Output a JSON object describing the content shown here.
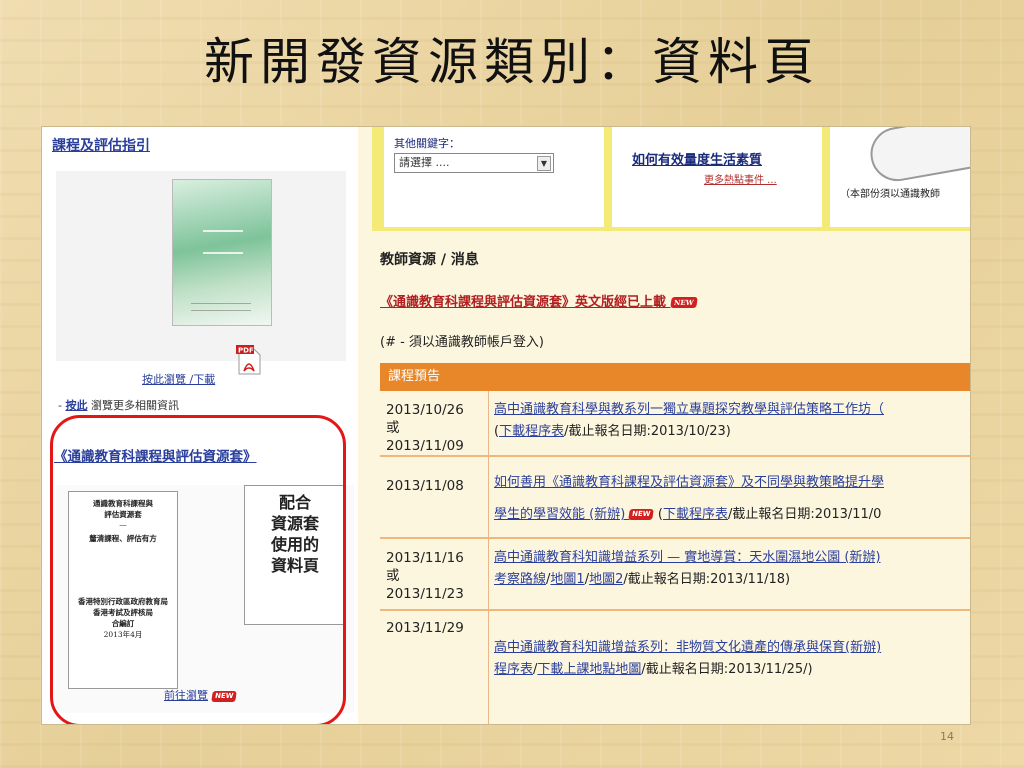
{
  "slide": {
    "title": "新開發資源類別：資料頁",
    "page_number": "14"
  },
  "left": {
    "title": "課程及評估指引",
    "pdf_link": "按此瀏覽 /下載",
    "more_prefix": "- ",
    "more_link": "按此",
    "more_text": " 瀏覽更多相關資訊",
    "set_title": "《通識教育科課程與評估資源套》",
    "doc_card": {
      "line1": "通識教育科課程與",
      "line2": "評估資源套",
      "dash": "—",
      "line3": "釐清課程、評估有方",
      "line4": "香港特別行政區政府教育局",
      "line5": "香港考試及評核局",
      "line6": "合編訂",
      "line7": "2013年4月"
    },
    "match_card": [
      "配合",
      "資源套",
      "使用的",
      "資料頁"
    ],
    "go_link": "前往瀏覽"
  },
  "top": {
    "keyword_label": "其他關鍵字：",
    "keyword_select": "請選擇 ....",
    "event_title": "如何有效量度生活素質",
    "event_more": "更多熱點事件 ...",
    "dash": "-",
    "note": "（本部份須以通識教師"
  },
  "resources": {
    "heading": "教師資源 / 消息",
    "link": "《通識教育科課程與評估資源套》英文版經已上載",
    "note": "(# - 須以通識教師帳戶登入)",
    "table_header": "課程預告"
  },
  "badge": "NEW",
  "rows": [
    {
      "date1": "2013/10/26",
      "or": "或",
      "date2": "2013/11/09",
      "title": "高中通識教育科學與教系列一獨立專題探究教學與評估策略工作坊（",
      "l1": "下載程序表",
      "tail1": "/截止報名日期:2013/10/23)"
    },
    {
      "date1": "2013/11/08",
      "title": "如何善用《通識教育科課程及評估資源套》及不同學與教策略提升學",
      "line2a": "學生的學習效能 (新辦) ",
      "l1": "下載程序表",
      "tail1": "/截止報名日期:2013/11/0"
    },
    {
      "date1": "2013/11/16",
      "or": "或",
      "date2": "2013/11/23",
      "title": "高中通識教育科知識增益系列 — 實地導賞：天水圍濕地公園 (新辦)",
      "l1": "考察路線",
      "l2": "地圖1",
      "l3": "地圖2",
      "tail1": "/截止報名日期:2013/11/18)"
    },
    {
      "date1": "2013/11/29",
      "title": "高中通識教育科知識增益系列：非物質文化遺產的傳承與保育(新辦)",
      "l1": "程序表",
      "l2": "下載上課地點地圖",
      "tail1": "/截止報名日期:2013/11/25/)"
    }
  ]
}
